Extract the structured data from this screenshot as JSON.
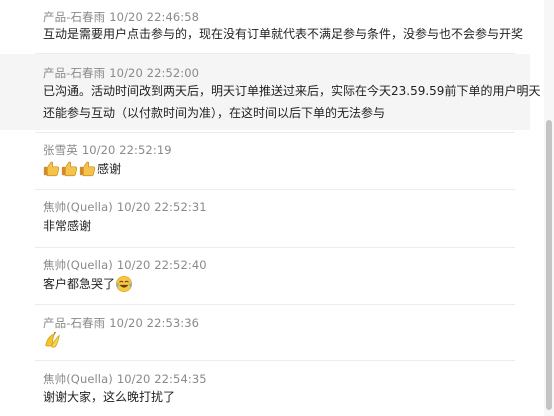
{
  "messages": [
    {
      "sender": "产品-石春雨",
      "time": "10/20 22:46:58",
      "lines": [
        "互动是需要用户点击参与的，现在没有订单就代表不满足参与条件，没参与也不会参与开奖"
      ]
    },
    {
      "sender": "产品-石春雨",
      "time": "10/20 22:52:00",
      "lines": [
        "已沟通。活动时间改到两天后，明天订单推送过来后，实际在今天23.59.59前下单的用户明天",
        "还能参与互动（以付款时间为准），在这时间以后下单的无法参与"
      ]
    },
    {
      "sender": "张雪英",
      "time": "10/20 22:52:19",
      "text": "感谢",
      "emoji": "thumbs-up-icon"
    },
    {
      "sender": "焦帅(Quella)",
      "time": "10/20 22:52:31",
      "text": "非常感谢"
    },
    {
      "sender": "焦帅(Quella)",
      "time": "10/20 22:52:40",
      "text": "客户都急哭了",
      "emoji": "tears-of-joy-icon"
    },
    {
      "sender": "产品-石春雨",
      "time": "10/20 22:53:36",
      "emoji": "banana-icon"
    },
    {
      "sender": "焦帅(Quella)",
      "time": "10/20 22:54:35",
      "text": "谢谢大家，这么晚打扰了"
    }
  ],
  "colors": {
    "sender": "#8a8a8a",
    "body": "#222222",
    "highlight_row": "#f5f5f5",
    "divider": "#ececec",
    "scroll_thumb": "#c4c4c4"
  }
}
